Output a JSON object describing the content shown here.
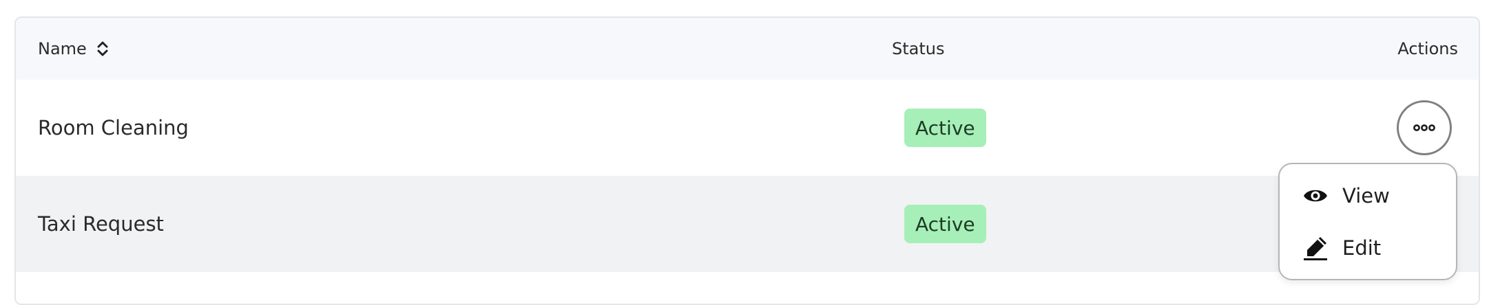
{
  "table": {
    "headers": {
      "name": "Name",
      "status": "Status",
      "actions": "Actions"
    },
    "rows": [
      {
        "name": "Room Cleaning",
        "status": "Active"
      },
      {
        "name": "Taxi Request",
        "status": "Active"
      }
    ]
  },
  "actions_menu": {
    "items": [
      {
        "label": "View",
        "icon": "eye-icon"
      },
      {
        "label": "Edit",
        "icon": "pencil-icon"
      }
    ]
  },
  "colors": {
    "status_active_bg": "#a6efb8",
    "header_bg": "#f7f8fc",
    "striped_row_bg": "#f1f2f3"
  }
}
